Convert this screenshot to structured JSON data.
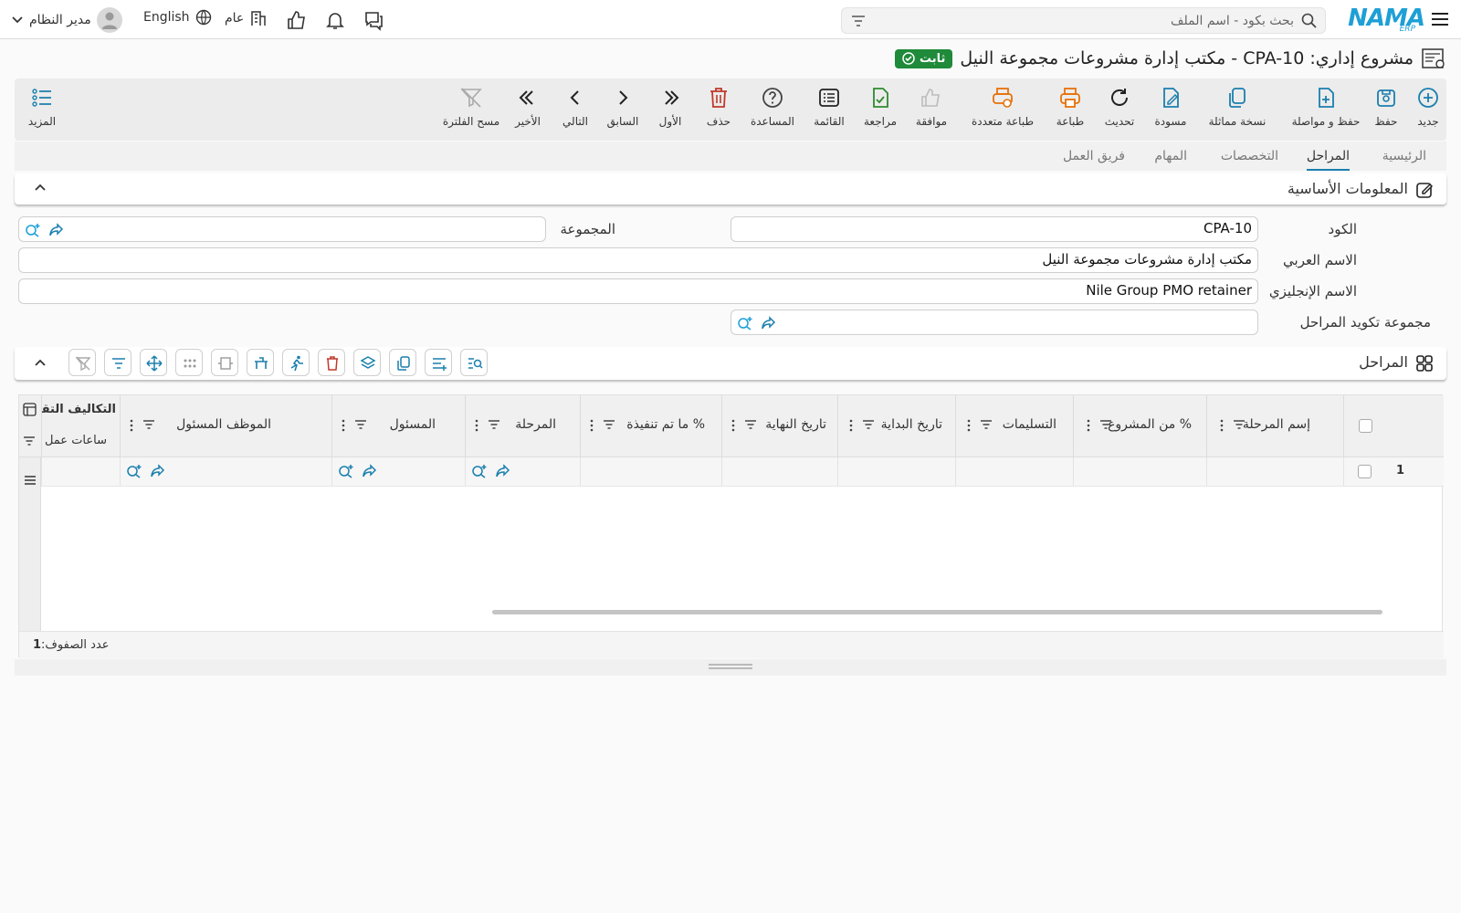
{
  "app": {
    "logo_text": "NAMA",
    "logo_sub": "ERP"
  },
  "topbar": {
    "search_placeholder": "بحث بكود - اسم الملف",
    "user_name": "مدير النظام",
    "language": "English",
    "scope": "عام"
  },
  "title": {
    "text": "مشروع إداري: CPA-10 - مكتب إدارة مشروعات مجموعة النيل",
    "status_badge": "ثابت",
    "status_color": "#1f8a3a"
  },
  "toolbar": {
    "new": "جديد",
    "save": "حفظ",
    "save_continue": "حفظ و مواصلة",
    "duplicate": "نسخة مماثلة",
    "draft": "مسودة",
    "refresh": "تحديث",
    "print": "طباعة",
    "multi_print": "طباعة متعددة",
    "approve": "موافقة",
    "review": "مراجعة",
    "list": "القائمة",
    "help": "المساعدة",
    "delete": "حذف",
    "first": "الأول",
    "previous": "السابق",
    "next": "التالي",
    "last": "الأخير",
    "clear_filter": "مسح الفلترة",
    "more": "المزيد"
  },
  "tabs": [
    {
      "label": "الرئيسية",
      "active": false
    },
    {
      "label": "المراحل",
      "active": true
    },
    {
      "label": "التخصصات",
      "active": false
    },
    {
      "label": "المهام",
      "active": false
    },
    {
      "label": "فريق العمل",
      "active": false
    }
  ],
  "basic_info": {
    "title": "المعلومات الأساسية",
    "code_label": "الكود",
    "code_value": "CPA-10",
    "group_label": "المجموعة",
    "group_value": "",
    "arabic_name_label": "الاسم العربي",
    "arabic_name_value": "مكتب إدارة مشروعات مجموعة النيل",
    "english_name_label": "الاسم الإنجليزي",
    "english_name_value": "Nile Group PMO retainer",
    "phase_coding_label": "مجموعة تكويد المراحل",
    "phase_coding_value": ""
  },
  "phases": {
    "title": "المراحل",
    "columns": [
      "إسم المرحلة",
      "% من المشروع",
      "التسليمات",
      "تاريخ البداية",
      "تاريخ النهاية",
      "% ما تم تنفيذة",
      "المرحلة",
      "المسئول",
      "الموظف المسئول",
      "التكاليف التقدي",
      "ساعات عمل"
    ],
    "rows": [
      {
        "index": "1"
      }
    ],
    "footer_label": "عدد الصفوف:",
    "row_count": "1"
  }
}
